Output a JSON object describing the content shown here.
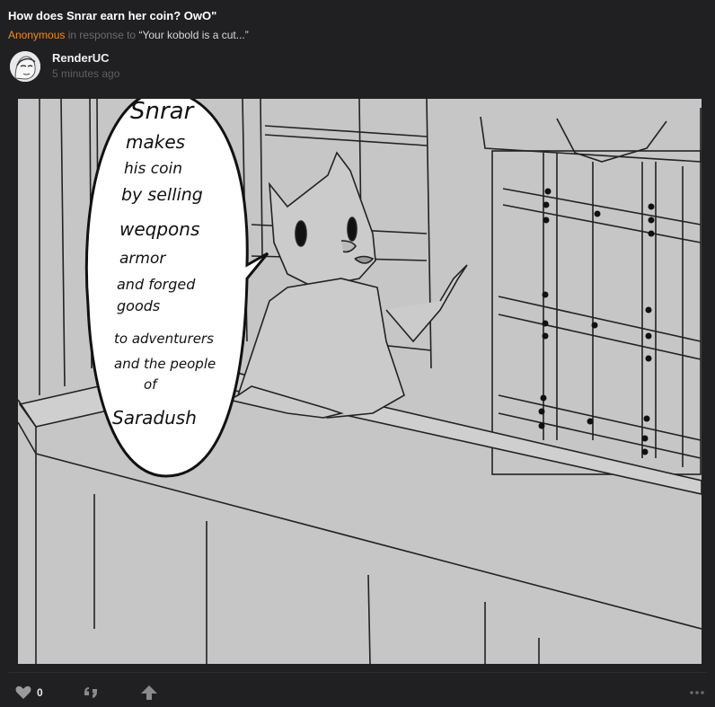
{
  "post": {
    "title": "How does Snrar earn her coin? OwO\"",
    "author_anon": "Anonymous",
    "in_response_to": "in response to",
    "quoted_text": "“Your kobold is a cut...”"
  },
  "comment": {
    "author": "RenderUC",
    "timestamp": "5 minutes ago",
    "comic": {
      "speech_lines": [
        "Snrar",
        "makes",
        "his coin",
        "by selling",
        "weqpons",
        "armor",
        "and forged",
        "goods",
        "to adventurers",
        "and the people",
        "of",
        "Saradush"
      ]
    },
    "likes": "0"
  },
  "icons": {
    "like": "heart-icon",
    "quote": "quote-icon",
    "upvote": "arrow-up-icon",
    "more": "more-dots-icon"
  },
  "colors": {
    "background": "#202022",
    "accent_anon": "#f08a24",
    "comic_bg": "#c6c6c6"
  }
}
